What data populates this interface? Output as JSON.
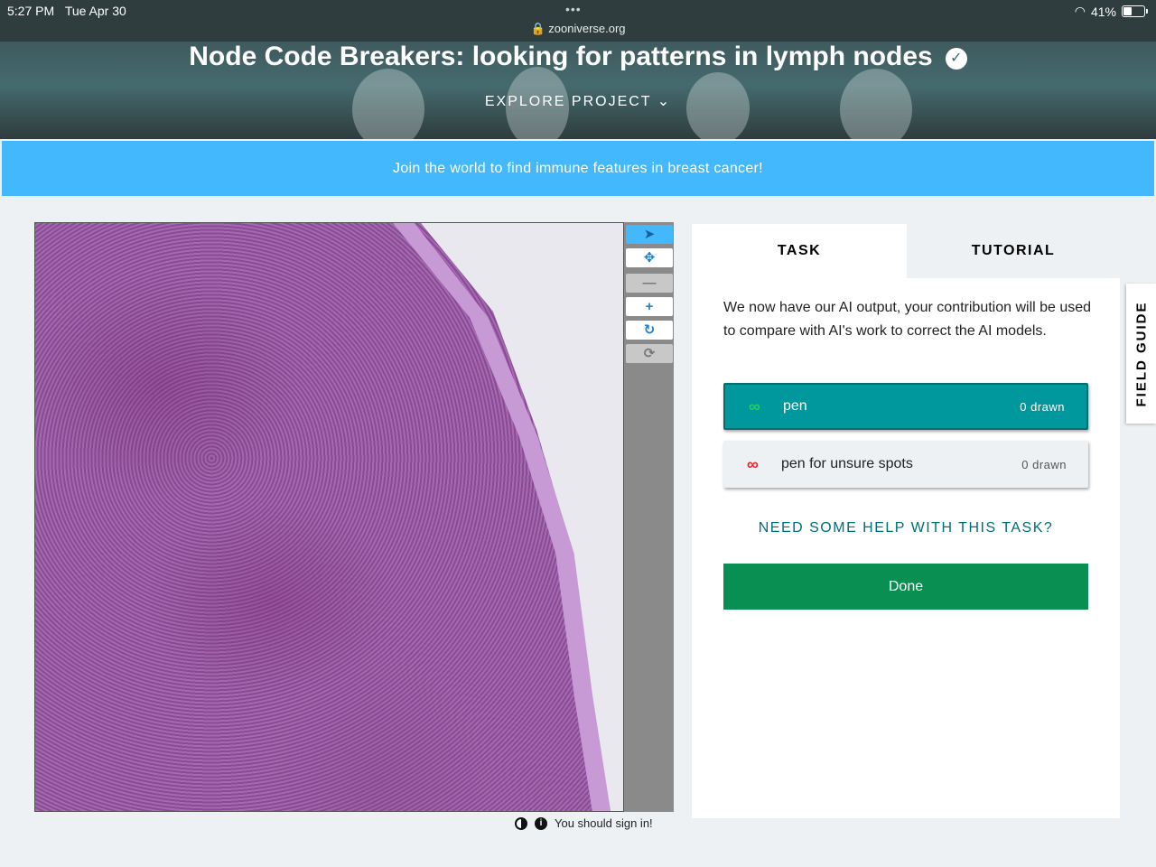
{
  "status_bar": {
    "time": "5:27 PM",
    "date": "Tue Apr 30",
    "url": "zooniverse.org",
    "battery": "41%"
  },
  "project": {
    "title": "Node Code Breakers: looking for patterns in lymph nodes",
    "explore_label": "EXPLORE PROJECT"
  },
  "banner": {
    "text": "Join the world to find immune features in breast cancer!"
  },
  "viewer": {
    "toolbar": [
      "pointer-icon",
      "move-icon",
      "zoom-out-icon",
      "zoom-in-icon",
      "rotate-icon",
      "reset-icon"
    ],
    "sign_in_text": "You should sign in!"
  },
  "task_panel": {
    "tabs": {
      "task": "TASK",
      "tutorial": "TUTORIAL"
    },
    "instructions": "We now have our AI output, your contribution will be used to compare with AI's work to correct the AI models.",
    "choices": [
      {
        "label": "pen",
        "count": "0 drawn",
        "color": "#1fd16a"
      },
      {
        "label": "pen for unsure spots",
        "count": "0 drawn",
        "color": "#e8262c"
      }
    ],
    "help_link": "NEED SOME HELP WITH THIS TASK?",
    "done_label": "Done"
  },
  "field_guide": {
    "label": "FIELD GUIDE"
  },
  "colors": {
    "banner": "#43b8fc",
    "active_tool": "#00979d",
    "done_button": "#0a8f52",
    "help_link": "#006d7a"
  }
}
